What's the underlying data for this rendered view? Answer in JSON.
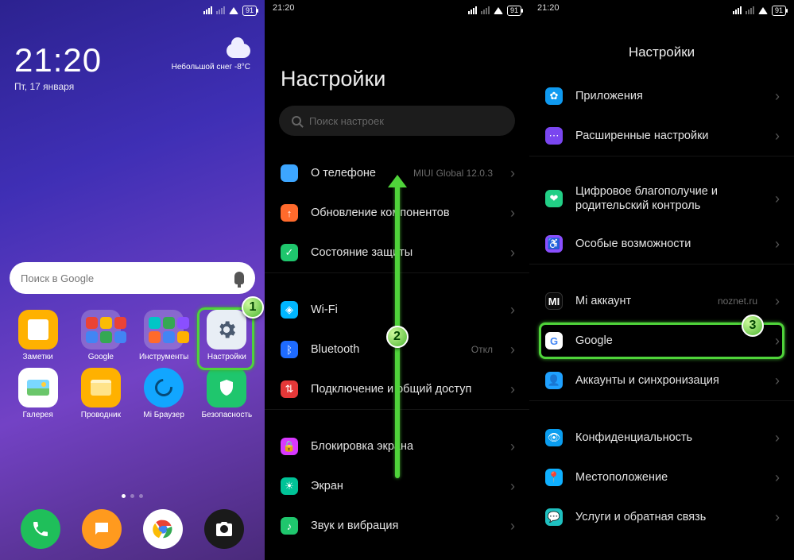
{
  "status": {
    "time": "21:20",
    "battery": "91"
  },
  "home": {
    "time": "21:20",
    "date": "Пт, 17 января",
    "weather_text": "Небольшой снег",
    "weather_temp": "-8°C",
    "search_placeholder": "Поиск в Google",
    "apps": {
      "notes": "Заметки",
      "google_folder": "Google",
      "tools_folder": "Инструменты",
      "settings": "Настройки",
      "gallery": "Галерея",
      "explorer": "Проводник",
      "browser": "Mi Браузер",
      "security": "Безопасность"
    }
  },
  "settings2": {
    "title": "Настройки",
    "search_placeholder": "Поиск настроек",
    "about": "О телефоне",
    "about_sub": "MIUI Global 12.0.3",
    "updates": "Обновление компонентов",
    "security": "Состояние защиты",
    "wifi": "Wi-Fi",
    "bluetooth": "Bluetooth",
    "bluetooth_sub": "Откл",
    "tether": "Подключение и общий доступ",
    "lock": "Блокировка экрана",
    "display": "Экран",
    "sound": "Звук и вибрация"
  },
  "settings3": {
    "title": "Настройки",
    "apps": "Приложения",
    "advanced": "Расширенные настройки",
    "wellbeing": "Цифровое благополучие и родительский контроль",
    "accessibility": "Особые возможности",
    "mi_account": "Mi аккаунт",
    "mi_account_sub": "noznet.ru",
    "google": "Google",
    "accounts": "Аккаунты и синхронизация",
    "privacy": "Конфиденциальность",
    "location": "Местоположение",
    "feedback": "Услуги и обратная связь"
  },
  "annot": {
    "step1": "1",
    "step2": "2",
    "step3": "3"
  }
}
